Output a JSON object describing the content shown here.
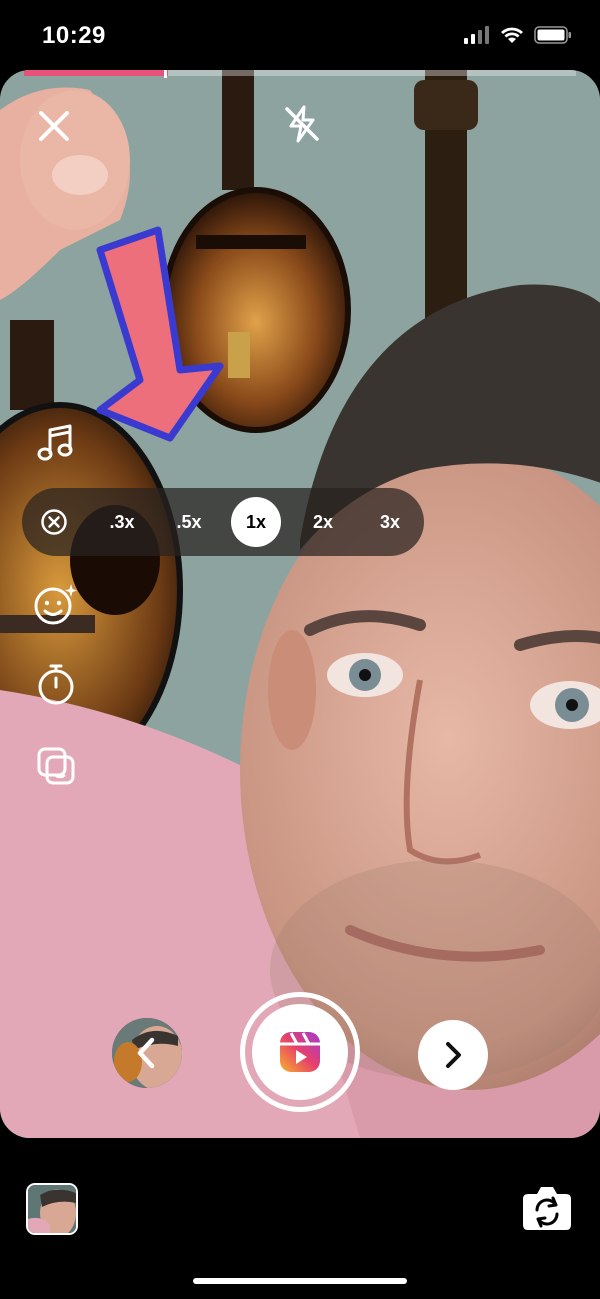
{
  "status_bar": {
    "time": "10:29",
    "icons": [
      "cellular-signal-icon",
      "wifi-icon",
      "battery-icon"
    ]
  },
  "recording": {
    "progress_fraction": 0.26,
    "accent_color": "#e9507a"
  },
  "camera_preview": {
    "visible_contents": "selfie camera view, man in pink t-shirt, mandolin and guitars on wall, hand holding paper arrow"
  },
  "top_controls": {
    "close_icon": "close-icon",
    "flash_icon": "flash-off-icon"
  },
  "side_tools": [
    {
      "name": "audio",
      "icon": "music-note-icon"
    },
    {
      "name": "effects",
      "icon": "face-sparkle-icon"
    },
    {
      "name": "timer",
      "icon": "timer-icon"
    },
    {
      "name": "align",
      "icon": "align-layers-icon"
    }
  ],
  "zoom": {
    "close_icon": "circle-x-icon",
    "options": [
      ".3x",
      ".5x",
      "1x",
      "2x",
      "3x"
    ],
    "selected": "1x"
  },
  "capture": {
    "icon": "reels-icon"
  },
  "navigation": {
    "prev_icon": "chevron-left-icon",
    "next_icon": "chevron-right-icon"
  },
  "bottom_bar": {
    "flip_icon": "flip-camera-icon"
  }
}
